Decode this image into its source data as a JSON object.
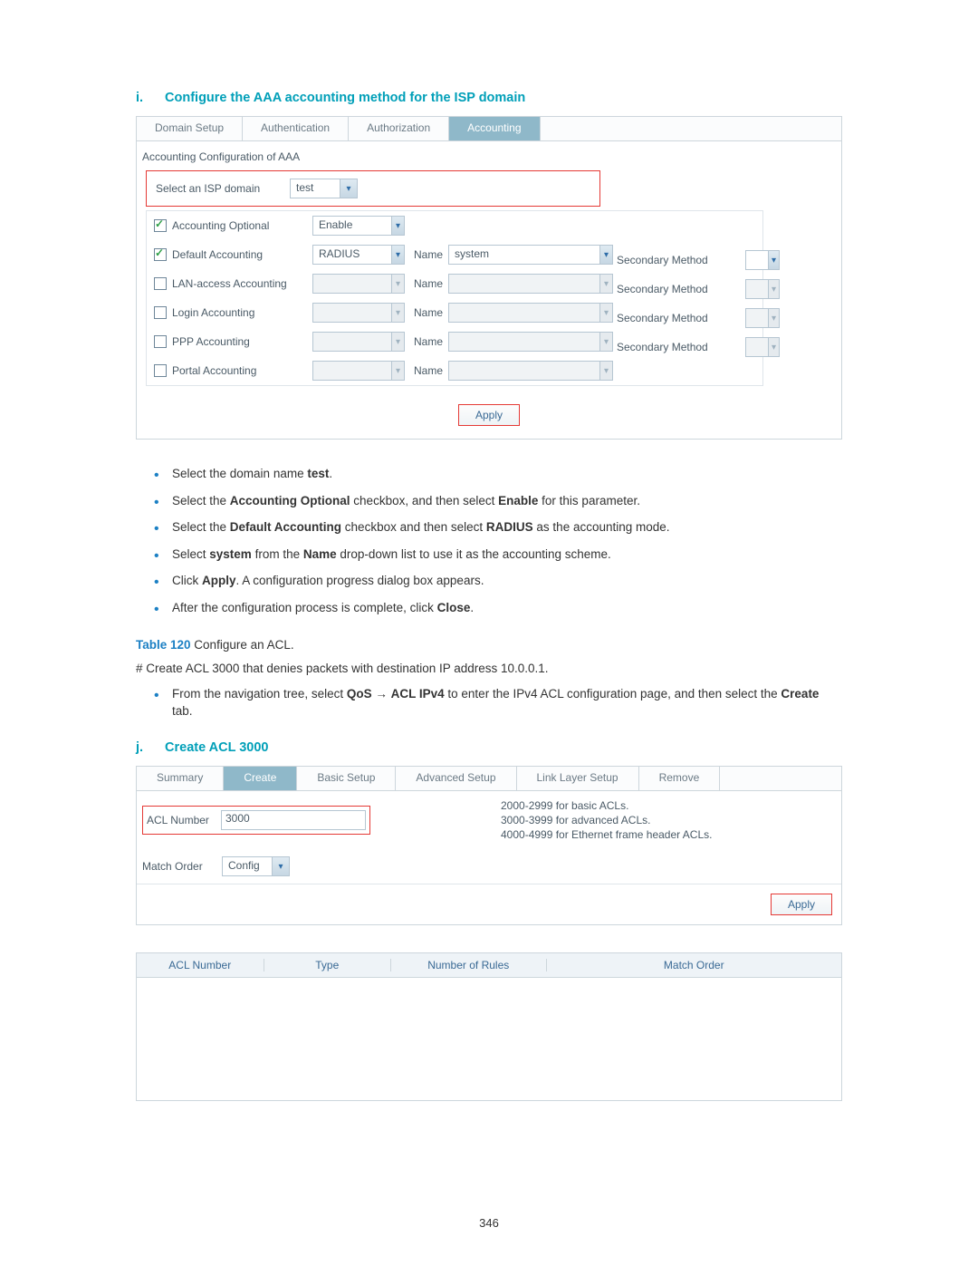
{
  "section_i": {
    "marker": "i.",
    "title": "Configure the AAA accounting method for the ISP domain"
  },
  "aaa": {
    "tabs": [
      "Domain Setup",
      "Authentication",
      "Authorization",
      "Accounting"
    ],
    "active_tab_index": 3,
    "subhead": "Accounting Configuration of AAA",
    "isp_label": "Select an ISP domain",
    "isp_value": "test",
    "rows": [
      {
        "label": "Accounting Optional",
        "checked": true,
        "mode": "Enable",
        "mode_enabled": true,
        "has_name": false,
        "name_value": "",
        "has_sec": false
      },
      {
        "label": "Default Accounting",
        "checked": true,
        "mode": "RADIUS",
        "mode_enabled": true,
        "has_name": true,
        "name_value": "system",
        "name_enabled": true,
        "has_sec": true,
        "sec_enabled": true
      },
      {
        "label": "LAN-access Accounting",
        "checked": false,
        "mode": "",
        "mode_enabled": false,
        "has_name": true,
        "name_value": "",
        "name_enabled": false,
        "has_sec": true,
        "sec_enabled": false
      },
      {
        "label": "Login Accounting",
        "checked": false,
        "mode": "",
        "mode_enabled": false,
        "has_name": true,
        "name_value": "",
        "name_enabled": false,
        "has_sec": true,
        "sec_enabled": false
      },
      {
        "label": "PPP Accounting",
        "checked": false,
        "mode": "",
        "mode_enabled": false,
        "has_name": true,
        "name_value": "",
        "name_enabled": false,
        "has_sec": true,
        "sec_enabled": false
      },
      {
        "label": "Portal Accounting",
        "checked": false,
        "mode": "",
        "mode_enabled": false,
        "has_name": true,
        "name_value": "",
        "name_enabled": false,
        "has_sec": false
      }
    ],
    "name_label": "Name",
    "sec_label": "Secondary Method",
    "apply": "Apply"
  },
  "instructions": [
    {
      "pre": "Select the domain name ",
      "b1": "test",
      "post": "."
    },
    {
      "pre": "Select the ",
      "b1": "Accounting Optional",
      "mid": " checkbox, and then select ",
      "b2": "Enable",
      "post": " for this parameter."
    },
    {
      "pre": "Select the ",
      "b1": "Default Accounting",
      "mid": " checkbox and then select ",
      "b2": "RADIUS",
      "post": " as the accounting mode."
    },
    {
      "pre": "Select ",
      "b1": "system",
      "mid": " from the ",
      "b2": "Name",
      "post": " drop-down list to use it as the accounting scheme."
    },
    {
      "pre": "Click ",
      "b1": "Apply",
      "post": ". A configuration progress dialog box appears."
    },
    {
      "pre": "After the configuration process is complete, click ",
      "b1": "Close",
      "post": "."
    }
  ],
  "table_ref": {
    "label": "Table 120",
    "rest": " Configure an ACL."
  },
  "hash_line": "# Create ACL 3000 that denies packets with destination IP address 10.0.0.1.",
  "nav_instr": {
    "pre": "From the navigation tree, select ",
    "b1": "QoS",
    "arrow": " → ",
    "b2": "ACL IPv4",
    "mid": " to enter the IPv4 ACL configuration page, and then select the ",
    "b3": "Create",
    "post": " tab."
  },
  "section_j": {
    "marker": "j.",
    "title": "Create ACL 3000"
  },
  "acl": {
    "tabs": [
      "Summary",
      "Create",
      "Basic Setup",
      "Advanced Setup",
      "Link Layer Setup",
      "Remove"
    ],
    "active_tab_index": 1,
    "aclnum_label": "ACL Number",
    "aclnum_value": "3000",
    "hints": [
      "2000-2999 for basic ACLs.",
      "3000-3999 for advanced ACLs.",
      "4000-4999 for Ethernet frame header ACLs."
    ],
    "match_label": "Match Order",
    "match_value": "Config",
    "apply": "Apply",
    "grid_headers": [
      "ACL Number",
      "Type",
      "Number of Rules",
      "Match Order"
    ]
  },
  "page_number": "346"
}
